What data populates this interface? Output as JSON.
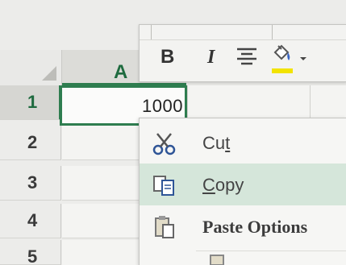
{
  "spreadsheet": {
    "column_header": "A",
    "row_numbers": [
      "1",
      "2",
      "3",
      "4",
      "5"
    ],
    "active_cell_value": "1000"
  },
  "mini_toolbar": {
    "bold_label": "B",
    "italic_label": "I",
    "fill_color": "#f2e300"
  },
  "context_menu": {
    "items": [
      {
        "label_first": "Cu",
        "label_ul": "t",
        "label_rest": "",
        "icon": "scissors-icon"
      },
      {
        "label_first": "",
        "label_ul": "C",
        "label_rest": "opy",
        "icon": "copy-icon"
      },
      {
        "label_first": "",
        "label_ul": "",
        "label_rest": "Paste Options",
        "icon": "paste-icon"
      }
    ]
  },
  "colors": {
    "accent_green": "#2e7d4f",
    "highlight": "#d5e6da"
  }
}
